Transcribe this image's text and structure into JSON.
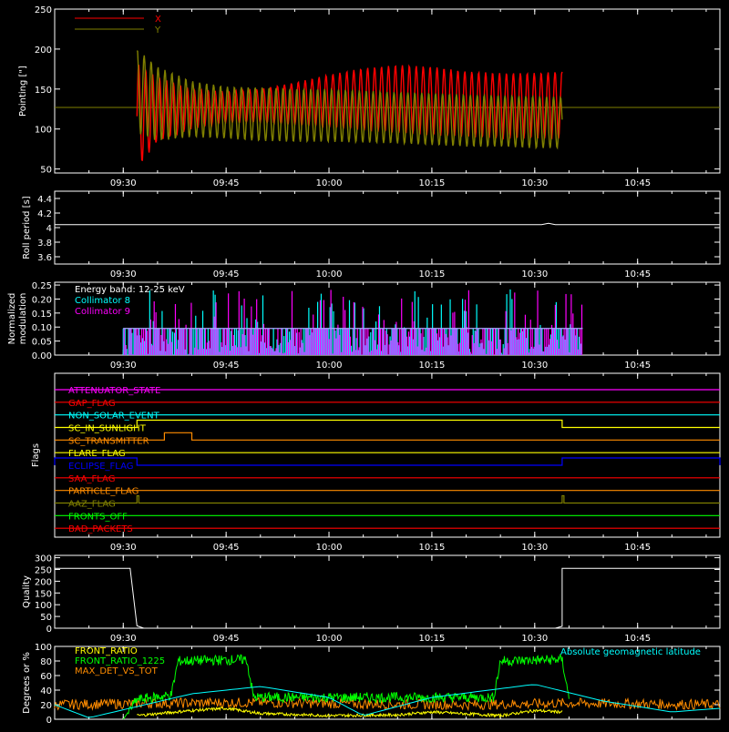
{
  "colors": {
    "background": "#000000",
    "axes": "#ffffff",
    "x_pointing": "#ff0000",
    "y_pointing": "#808000",
    "roll": "#ffffff",
    "collimator8": "#00ffff",
    "collimator9": "#ff00ff",
    "front_ratio": "#ffff00",
    "front_ratio_1225": "#00ff00",
    "max_det": "#ff8c00",
    "geomag": "#00ffff"
  },
  "time_axis": {
    "start": "09:20",
    "end": "10:57",
    "tick_labels": [
      "09:30",
      "09:45",
      "10:00",
      "10:15",
      "10:30",
      "10:45"
    ],
    "tick_times": [
      "09:30",
      "09:45",
      "10:00",
      "10:15",
      "10:30",
      "10:45"
    ]
  },
  "chart_data": [
    {
      "id": "pointing",
      "type": "line",
      "ylabel": "Pointing [\"]",
      "ylim": [
        45,
        250
      ],
      "yticks": [
        50,
        100,
        150,
        200,
        250
      ],
      "legend": [
        "X",
        "Y"
      ],
      "legend_placement": "top-left",
      "reference_level": 127,
      "series": [
        {
          "name": "X",
          "start": "09:32",
          "end": "10:34",
          "envelope_time": [
            "09:32",
            "09:35",
            "09:40",
            "09:45",
            "09:50",
            "09:55",
            "10:00",
            "10:05",
            "10:10",
            "10:15",
            "10:20",
            "10:25",
            "10:30",
            "10:34"
          ],
          "envelope_max": [
            182,
            165,
            150,
            147,
            150,
            158,
            168,
            176,
            180,
            178,
            172,
            170,
            170,
            172
          ],
          "envelope_min": [
            50,
            85,
            100,
            108,
            108,
            105,
            102,
            98,
            95,
            92,
            90,
            88,
            88,
            88
          ]
        },
        {
          "name": "Y",
          "start": "09:32",
          "end": "10:34",
          "envelope_time": [
            "09:32",
            "09:35",
            "09:40",
            "09:45",
            "09:50",
            "09:55",
            "10:00",
            "10:05",
            "10:10",
            "10:15",
            "10:20",
            "10:25",
            "10:30",
            "10:34"
          ],
          "envelope_max": [
            200,
            178,
            160,
            153,
            152,
            150,
            150,
            148,
            146,
            145,
            143,
            142,
            141,
            140
          ],
          "envelope_min": [
            95,
            85,
            90,
            88,
            85,
            84,
            84,
            83,
            82,
            80,
            78,
            78,
            76,
            76
          ]
        }
      ]
    },
    {
      "id": "roll",
      "type": "line",
      "ylabel": "Roll period [s]",
      "ylim": [
        3.5,
        4.5
      ],
      "yticks": [
        3.6,
        3.8,
        4.0,
        4.2,
        4.4
      ],
      "series": [
        {
          "name": "Roll period",
          "time": [
            "09:20",
            "10:31",
            "10:32",
            "10:33",
            "10:57"
          ],
          "values": [
            4.04,
            4.04,
            4.06,
            4.04,
            4.04
          ]
        }
      ]
    },
    {
      "id": "modulation",
      "type": "bar",
      "ylabel": "Normalized modulation",
      "ylim": [
        0,
        0.26
      ],
      "yticks": [
        0.0,
        0.05,
        0.1,
        0.15,
        0.2,
        0.25
      ],
      "yticklabels": [
        "0.00",
        "0.05",
        "0.10",
        "0.15",
        "0.20",
        "0.25"
      ],
      "annotation": "Energy band: 12-25 keV",
      "legend_placement": "top-left",
      "baseline": 0.095,
      "series": [
        {
          "name": "Collimator 8",
          "start": "09:30",
          "end": "10:37"
        },
        {
          "name": "Collimator 9",
          "start": "09:30",
          "end": "10:37"
        }
      ]
    },
    {
      "id": "flags",
      "type": "line",
      "ylabel": "Flags",
      "series": [
        {
          "name": "ATTENUATOR_STATE",
          "color": "#ff00ff",
          "high_intervals": []
        },
        {
          "name": "GAP_FLAG",
          "color": "#ff0000",
          "high_intervals": []
        },
        {
          "name": "NON_SOLAR_EVENT",
          "color": "#00ffff",
          "high_intervals": []
        },
        {
          "name": "SC_IN_SUNLIGHT",
          "color": "#ffff00",
          "high_intervals": [
            [
              "09:32",
              "10:34"
            ]
          ]
        },
        {
          "name": "SC_TRANSMITTER",
          "color": "#ff8c00",
          "high_intervals": [
            [
              "09:36",
              "09:40"
            ]
          ]
        },
        {
          "name": "FLARE_FLAG",
          "color": "#ffff00",
          "high_intervals": []
        },
        {
          "name": "ECLIPSE_FLAG",
          "color": "#0000ff",
          "high_intervals": [
            [
              "09:20",
              "09:32"
            ],
            [
              "10:34",
              "10:57"
            ]
          ]
        },
        {
          "name": "SAA_FLAG",
          "color": "#ff0000",
          "high_intervals": []
        },
        {
          "name": "PARTICLE_FLAG",
          "color": "#ff8c00",
          "high_intervals": []
        },
        {
          "name": "AAZ_FLAG",
          "color": "#808000",
          "high_intervals": [
            [
              "09:32",
              "09:32"
            ],
            [
              "10:34",
              "10:34"
            ]
          ]
        },
        {
          "name": "FRONTS_OFF",
          "color": "#00ff00",
          "high_intervals": []
        },
        {
          "name": "BAD_PACKETS",
          "color": "#ff0000",
          "high_intervals": []
        }
      ]
    },
    {
      "id": "quality",
      "type": "line",
      "ylabel": "Quality",
      "ylim": [
        0,
        310
      ],
      "yticks": [
        0,
        50,
        100,
        150,
        200,
        250,
        300
      ],
      "series": [
        {
          "name": "Quality",
          "time": [
            "09:20",
            "09:31",
            "09:32",
            "09:33",
            "10:33",
            "10:34",
            "10:34",
            "10:57"
          ],
          "values": [
            255,
            255,
            10,
            0,
            0,
            8,
            255,
            255
          ]
        }
      ]
    },
    {
      "id": "ratios",
      "type": "line",
      "ylabel": "Degrees or %",
      "ylim": [
        0,
        100
      ],
      "yticks": [
        0,
        20,
        40,
        60,
        80,
        100
      ],
      "legend": [
        "FRONT_RATIO",
        "FRONT_RATIO_1225",
        "MAX_DET_VS_TOT"
      ],
      "legend_placement": "top-left",
      "annotation": "Absolute geomagnetic latitude",
      "series": [
        {
          "name": "FRONT_RATIO",
          "time": [
            "09:32",
            "09:40",
            "09:45",
            "09:50",
            "10:00",
            "10:10",
            "10:15",
            "10:25",
            "10:30",
            "10:34"
          ],
          "values": [
            5,
            12,
            15,
            8,
            5,
            6,
            10,
            5,
            12,
            10
          ]
        },
        {
          "name": "FRONT_RATIO_1225",
          "time": [
            "09:30",
            "09:32",
            "09:37",
            "09:38",
            "09:48",
            "09:49",
            "10:24",
            "10:25",
            "10:34",
            "10:35"
          ],
          "values": [
            0,
            27,
            33,
            80,
            82,
            30,
            30,
            80,
            82,
            28
          ]
        },
        {
          "name": "MAX_DET_VS_TOT",
          "time": [
            "09:20",
            "09:35",
            "09:50",
            "10:05",
            "10:20",
            "10:35",
            "10:57"
          ],
          "values": [
            20,
            22,
            23,
            21,
            20,
            22,
            20
          ]
        },
        {
          "name": "Absolute geomagnetic latitude",
          "time": [
            "09:20",
            "09:25",
            "09:40",
            "09:50",
            "10:00",
            "10:05",
            "10:15",
            "10:30",
            "10:40",
            "10:50",
            "10:57"
          ],
          "values": [
            20,
            2,
            35,
            45,
            30,
            5,
            30,
            48,
            25,
            10,
            15
          ]
        }
      ]
    }
  ]
}
